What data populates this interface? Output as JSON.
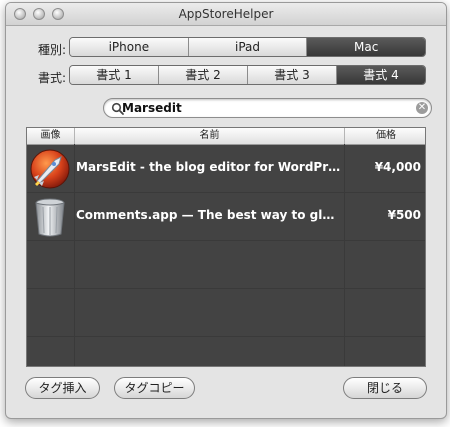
{
  "window": {
    "title": "AppStoreHelper"
  },
  "kind": {
    "label": "種別:",
    "options": [
      "iPhone",
      "iPad",
      "Mac"
    ],
    "selected": 2
  },
  "format": {
    "label": "書式:",
    "options": [
      "書式 1",
      "書式 2",
      "書式 3",
      "書式 4"
    ],
    "selected": 3
  },
  "search": {
    "value": "Marsedit",
    "placeholder": ""
  },
  "table": {
    "columns": [
      "画像",
      "名前",
      "価格"
    ],
    "rows": [
      {
        "icon": "marsedit-rocket-icon",
        "name": "MarsEdit - the blog editor for WordPress, T...",
        "price": "¥4,000"
      },
      {
        "icon": "trash-can-icon",
        "name": "Comments.app — The best way to glance at...",
        "price": "¥500"
      }
    ]
  },
  "buttons": {
    "insert_tag": "タグ挿入",
    "copy_tag": "タグコピー",
    "close": "閉じる"
  },
  "colors": {
    "table_bg": "#434343",
    "selected_segment": "#464646"
  }
}
